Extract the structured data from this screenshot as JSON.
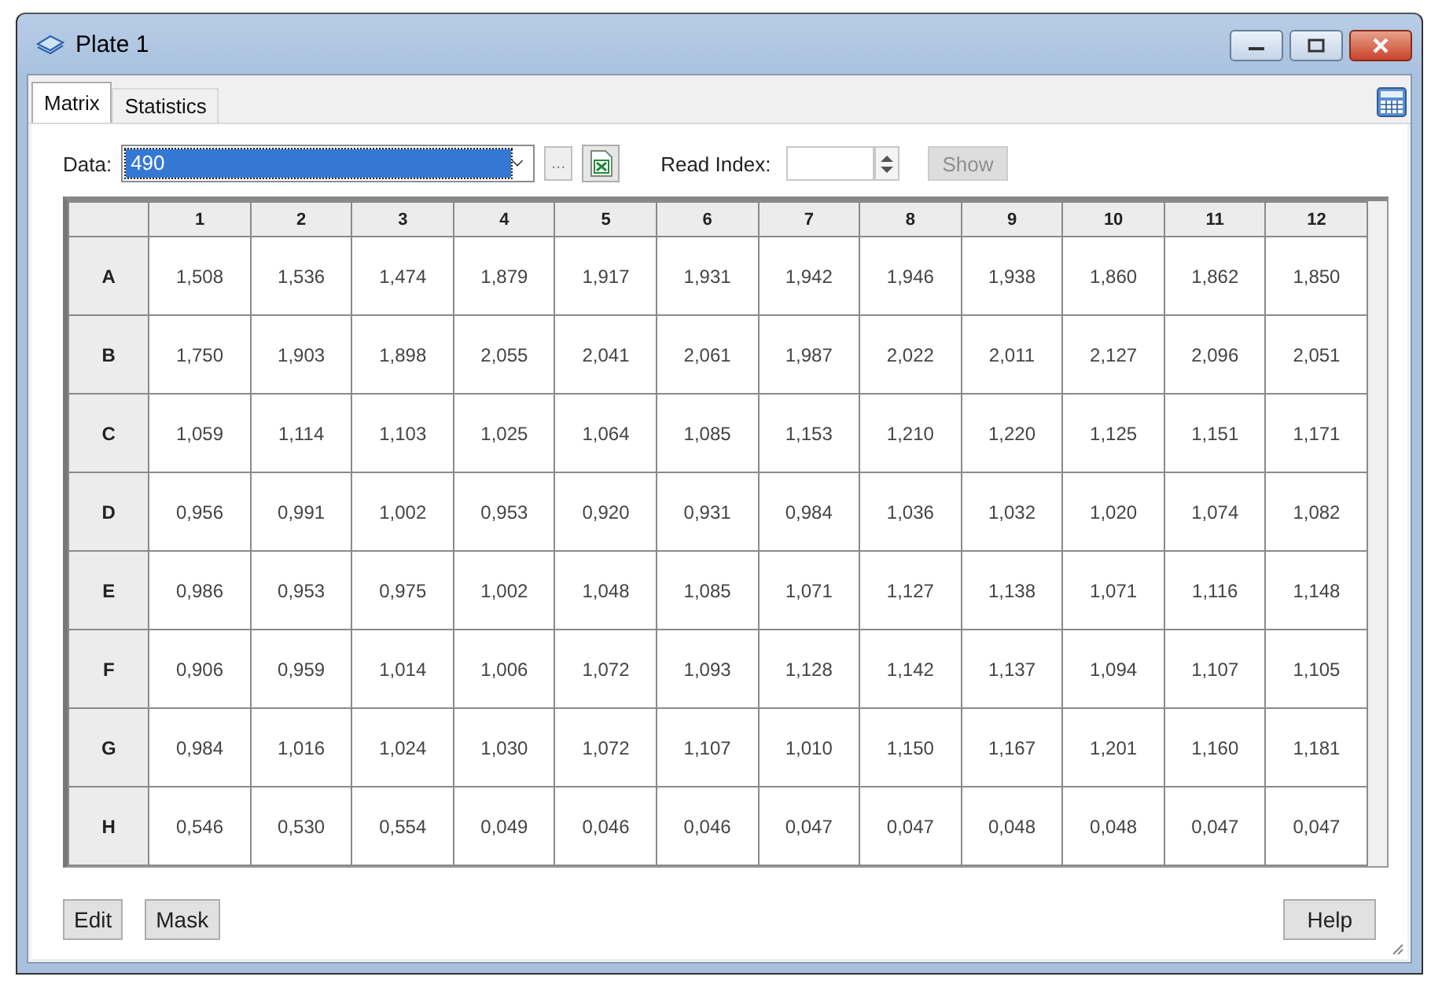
{
  "window": {
    "title": "Plate 1"
  },
  "tabs": [
    {
      "label": "Matrix",
      "selected": true
    },
    {
      "label": "Statistics",
      "selected": false
    }
  ],
  "data_field": {
    "label": "Data:",
    "value": "490",
    "highlighted": true,
    "browse_button": "..."
  },
  "read_index": {
    "label": "Read Index:",
    "show_button": {
      "label": "Show",
      "disabled": true
    }
  },
  "table": {
    "columns": [
      "1",
      "2",
      "3",
      "4",
      "5",
      "6",
      "7",
      "8",
      "9",
      "10",
      "11",
      "12"
    ],
    "rows": [
      {
        "label": "A",
        "cells": [
          "1,508",
          "1,536",
          "1,474",
          "1,879",
          "1,917",
          "1,931",
          "1,942",
          "1,946",
          "1,938",
          "1,860",
          "1,862",
          "1,850"
        ]
      },
      {
        "label": "B",
        "cells": [
          "1,750",
          "1,903",
          "1,898",
          "2,055",
          "2,041",
          "2,061",
          "1,987",
          "2,022",
          "2,011",
          "2,127",
          "2,096",
          "2,051"
        ]
      },
      {
        "label": "C",
        "cells": [
          "1,059",
          "1,114",
          "1,103",
          "1,025",
          "1,064",
          "1,085",
          "1,153",
          "1,210",
          "1,220",
          "1,125",
          "1,151",
          "1,171"
        ]
      },
      {
        "label": "D",
        "cells": [
          "0,956",
          "0,991",
          "1,002",
          "0,953",
          "0,920",
          "0,931",
          "0,984",
          "1,036",
          "1,032",
          "1,020",
          "1,074",
          "1,082"
        ]
      },
      {
        "label": "E",
        "cells": [
          "0,986",
          "0,953",
          "0,975",
          "1,002",
          "1,048",
          "1,085",
          "1,071",
          "1,127",
          "1,138",
          "1,071",
          "1,116",
          "1,148"
        ]
      },
      {
        "label": "F",
        "cells": [
          "0,906",
          "0,959",
          "1,014",
          "1,006",
          "1,072",
          "1,093",
          "1,128",
          "1,142",
          "1,137",
          "1,094",
          "1,107",
          "1,105"
        ]
      },
      {
        "label": "G",
        "cells": [
          "0,984",
          "1,016",
          "1,024",
          "1,030",
          "1,072",
          "1,107",
          "1,010",
          "1,150",
          "1,167",
          "1,201",
          "1,160",
          "1,181"
        ]
      },
      {
        "label": "H",
        "cells": [
          "0,546",
          "0,530",
          "0,554",
          "0,049",
          "0,046",
          "0,046",
          "0,047",
          "0,047",
          "0,048",
          "0,048",
          "0,047",
          "0,047"
        ]
      }
    ]
  },
  "buttons": [
    {
      "label": "Edit",
      "disabled": false
    },
    {
      "label": "Mask",
      "disabled": false
    },
    {
      "label": "Help",
      "disabled": false
    }
  ]
}
